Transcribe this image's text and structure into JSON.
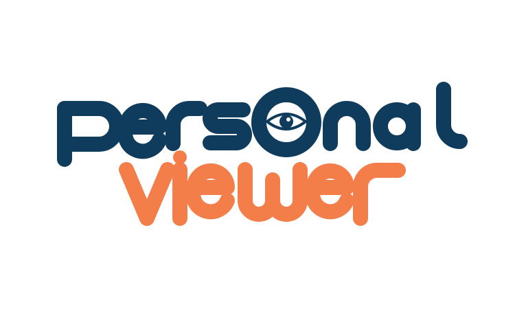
{
  "logo": {
    "line1": "personal",
    "line2": "viewer",
    "icon": "eye-icon",
    "colors": {
      "navy": "#0f3b5c",
      "orange": "#f47e4a",
      "background": "#ffffff"
    }
  }
}
